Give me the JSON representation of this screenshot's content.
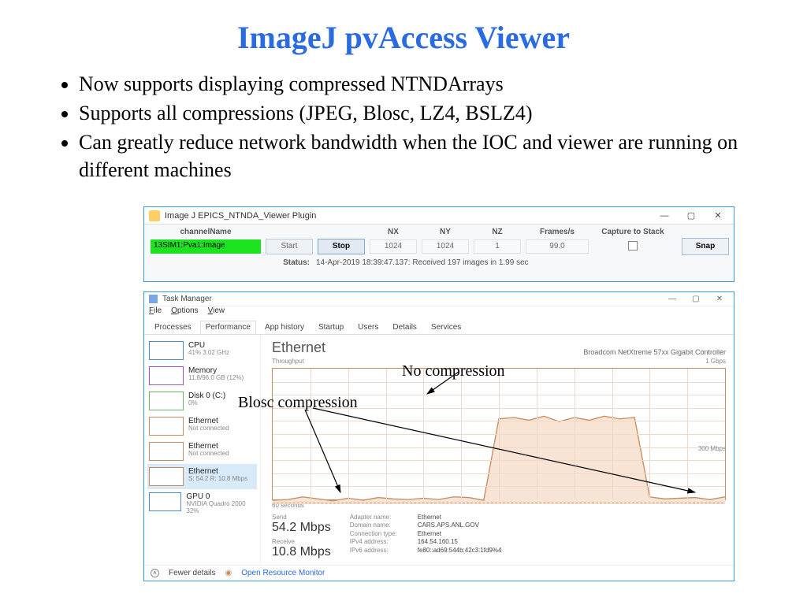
{
  "title": "ImageJ pvAccess Viewer",
  "bullets": [
    "Now supports displaying compressed NTNDArrays",
    "Supports all compressions (JPEG, Blosc, LZ4, BSLZ4)",
    "Can greatly reduce network bandwidth when the IOC and viewer are running on different machines"
  ],
  "ij": {
    "window_title": "Image J EPICS_NTNDA_Viewer Plugin",
    "labels": {
      "channel": "channelName",
      "nx": "NX",
      "ny": "NY",
      "nz": "NZ",
      "fps": "Frames/s",
      "capture": "Capture to Stack"
    },
    "channel_value": "13SIM1:Pva1:Image",
    "buttons": {
      "start": "Start",
      "stop": "Stop",
      "snap": "Snap"
    },
    "values": {
      "nx": "1024",
      "ny": "1024",
      "nz": "1",
      "fps": "99.0"
    },
    "status_label": "Status:",
    "status_text": "14-Apr-2019 18:39:47.137: Received 197 images in 1.99 sec"
  },
  "tm": {
    "window_title": "Task Manager",
    "menu": {
      "file": "File",
      "options": "Options",
      "view": "View"
    },
    "tabs": [
      "Processes",
      "Performance",
      "App history",
      "Startup",
      "Users",
      "Details",
      "Services"
    ],
    "selected_tab": "Performance",
    "side": [
      {
        "name": "cpu",
        "title": "CPU",
        "sub": "41% 3.02 GHz",
        "color": "#4c8ad8"
      },
      {
        "name": "mem",
        "title": "Memory",
        "sub": "11.8/96.0 GB (12%)",
        "color": "#a252c8"
      },
      {
        "name": "disk",
        "title": "Disk 0 (C:)",
        "sub": "0%",
        "color": "#6db36d"
      },
      {
        "name": "eth0",
        "title": "Ethernet",
        "sub": "Not connected",
        "color": "#c78b60"
      },
      {
        "name": "eth1",
        "title": "Ethernet",
        "sub": "Not connected",
        "color": "#c78b60"
      },
      {
        "name": "eth2",
        "title": "Ethernet",
        "sub": "S: 54.2 R: 10.8 Mbps",
        "color": "#c78b60",
        "selected": true
      },
      {
        "name": "gpu",
        "title": "GPU 0",
        "sub": "NVIDIA Quadro 2000\n32%",
        "color": "#4c8ad8"
      }
    ],
    "main": {
      "heading": "Ethernet",
      "adapter": "Broadcom NetXtreme 57xx Gigabit Controller",
      "sub_left": "Throughput",
      "sub_right_top": "1 Gbps",
      "sub_right_mid": "300 Mbps",
      "axis_left": "60 seconds",
      "send_label": "Send",
      "send_value": "54.2 Mbps",
      "recv_label": "Receive",
      "recv_value": "10.8 Mbps",
      "props": [
        {
          "k": "Adapter name:",
          "v": "Ethernet"
        },
        {
          "k": "Domain name:",
          "v": "CARS.APS.ANL.GOV"
        },
        {
          "k": "Connection type:",
          "v": "Ethernet"
        },
        {
          "k": "IPv4 address:",
          "v": "164.54.160.15"
        },
        {
          "k": "IPv6 address:",
          "v": "fe80::ad69:544b:42c3:1fd9%4"
        }
      ]
    },
    "footer": {
      "fewer": "Fewer details",
      "orm": "Open Resource Monitor"
    }
  },
  "annotations": {
    "no_compression": "No compression",
    "blosc": "Blosc compression"
  },
  "chart_data": {
    "type": "line",
    "title": "Ethernet Throughput",
    "xlabel": "60 seconds",
    "ylabel": "Throughput",
    "ylim": [
      0,
      1000
    ],
    "unit": "Mbps",
    "x": [
      0,
      2,
      4,
      6,
      8,
      10,
      12,
      14,
      16,
      18,
      20,
      22,
      24,
      26,
      28,
      30,
      32,
      34,
      36,
      38,
      40,
      42,
      44,
      46,
      48,
      50,
      52,
      54,
      56,
      58,
      60
    ],
    "series": [
      {
        "name": "Send",
        "values": [
          30,
          35,
          55,
          40,
          25,
          45,
          30,
          50,
          40,
          35,
          45,
          35,
          55,
          50,
          30,
          630,
          640,
          620,
          650,
          610,
          640,
          620,
          650,
          630,
          640,
          55,
          40,
          45,
          50,
          35,
          55
        ]
      },
      {
        "name": "Receive",
        "values": [
          8,
          10,
          12,
          9,
          8,
          10,
          9,
          11,
          10,
          9,
          10,
          9,
          11,
          10,
          9,
          12,
          11,
          10,
          12,
          11,
          10,
          12,
          11,
          10,
          12,
          9,
          10,
          11,
          10,
          9,
          11
        ]
      }
    ],
    "annotations": [
      {
        "label": "Blosc compression",
        "x_range": [
          0,
          28
        ],
        "approx_mbps": 45
      },
      {
        "label": "No compression",
        "x_range": [
          30,
          48
        ],
        "approx_mbps": 630
      }
    ]
  }
}
